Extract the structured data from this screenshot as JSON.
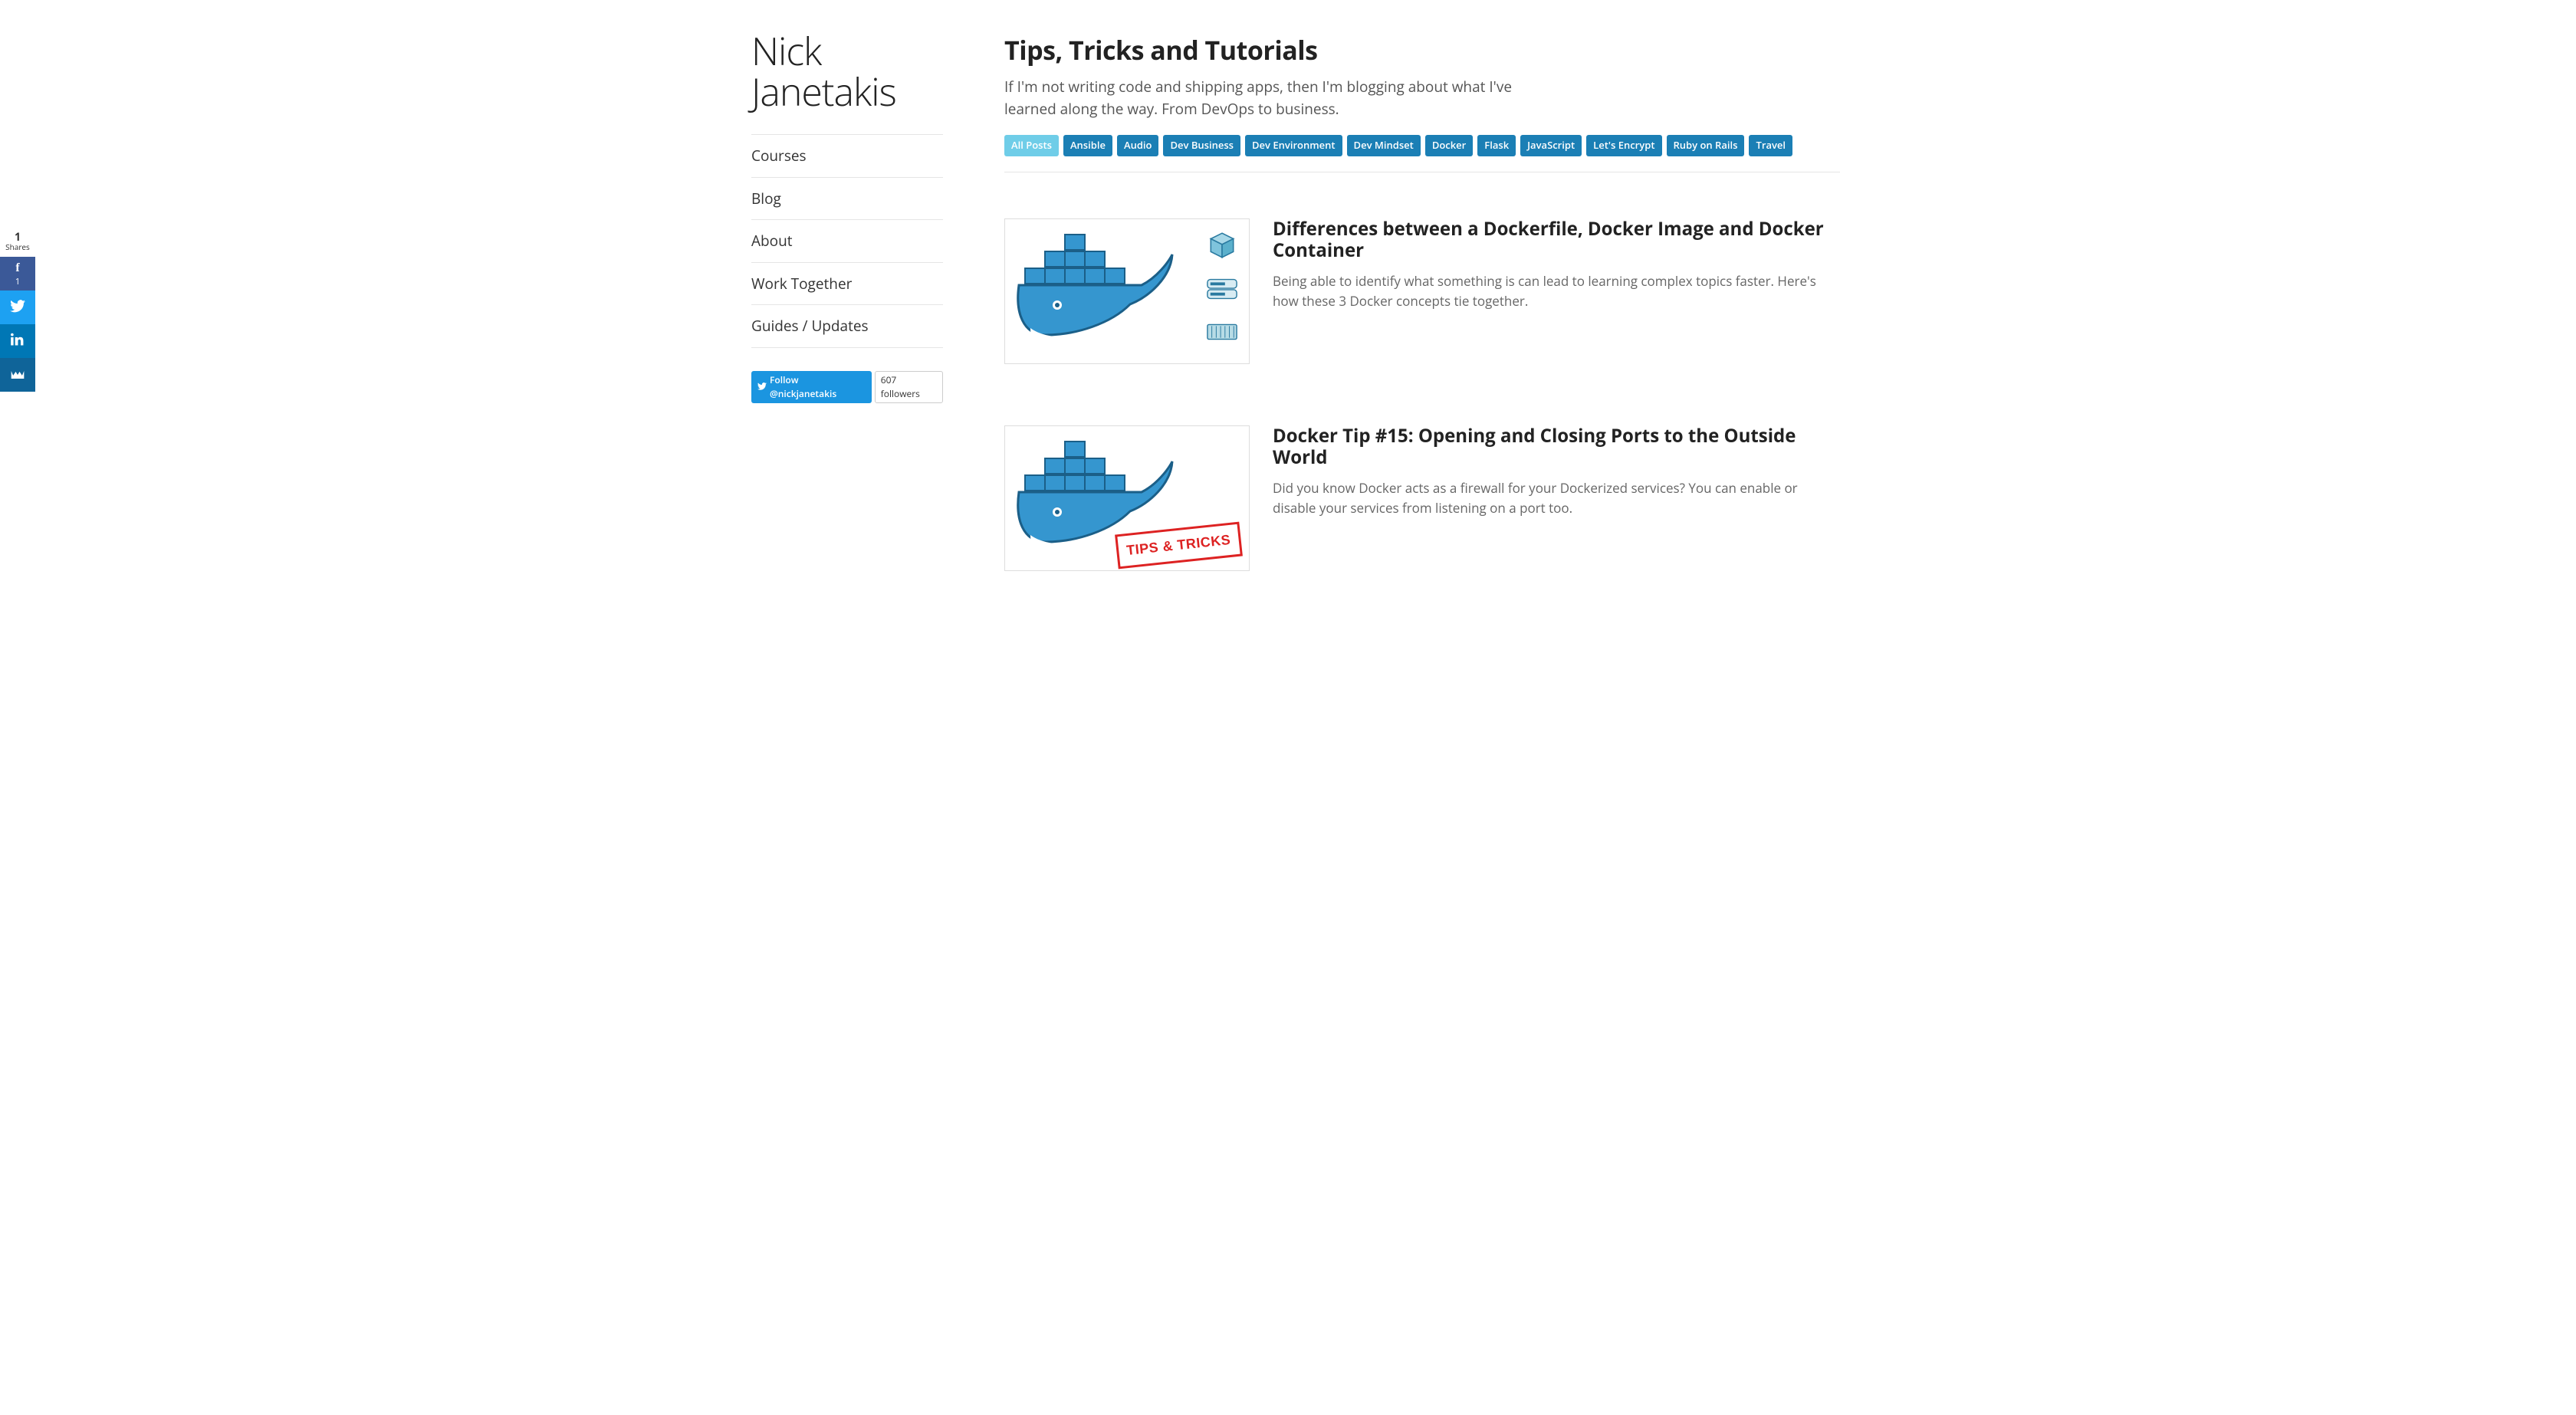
{
  "site": {
    "title": "Nick Janetakis"
  },
  "nav": {
    "items": [
      {
        "label": "Courses"
      },
      {
        "label": "Blog"
      },
      {
        "label": "About"
      },
      {
        "label": "Work Together"
      },
      {
        "label": "Guides / Updates"
      }
    ]
  },
  "twitter": {
    "follow_label": "Follow @nickjanetakis",
    "followers": "607 followers"
  },
  "header": {
    "title": "Tips, Tricks and Tutorials",
    "subtitle": "If I'm not writing code and shipping apps, then I'm blogging about what I've learned along the way. From DevOps to business."
  },
  "tags": [
    {
      "label": "All Posts",
      "active": true
    },
    {
      "label": "Ansible",
      "active": false
    },
    {
      "label": "Audio",
      "active": false
    },
    {
      "label": "Dev Business",
      "active": false
    },
    {
      "label": "Dev Environment",
      "active": false
    },
    {
      "label": "Dev Mindset",
      "active": false
    },
    {
      "label": "Docker",
      "active": false
    },
    {
      "label": "Flask",
      "active": false
    },
    {
      "label": "JavaScript",
      "active": false
    },
    {
      "label": "Let's Encrypt",
      "active": false
    },
    {
      "label": "Ruby on Rails",
      "active": false
    },
    {
      "label": "Travel",
      "active": false
    }
  ],
  "posts": [
    {
      "title": "Differences between a Dockerfile, Docker Image and Docker Container",
      "excerpt": "Being able to identify what something is can lead to learning complex topics faster. Here's how these 3 Docker concepts tie together.",
      "thumb_variant": "icons"
    },
    {
      "title": "Docker Tip #15: Opening and Closing Ports to the Outside World",
      "excerpt": "Did you know Docker acts as a firewall for your Dockerized services? You can enable or disable your services from listening on a port too.",
      "thumb_variant": "tips",
      "stamp": "TIPS & TRICKS"
    }
  ],
  "share": {
    "count": "1",
    "label": "Shares",
    "fb_count": "1"
  }
}
